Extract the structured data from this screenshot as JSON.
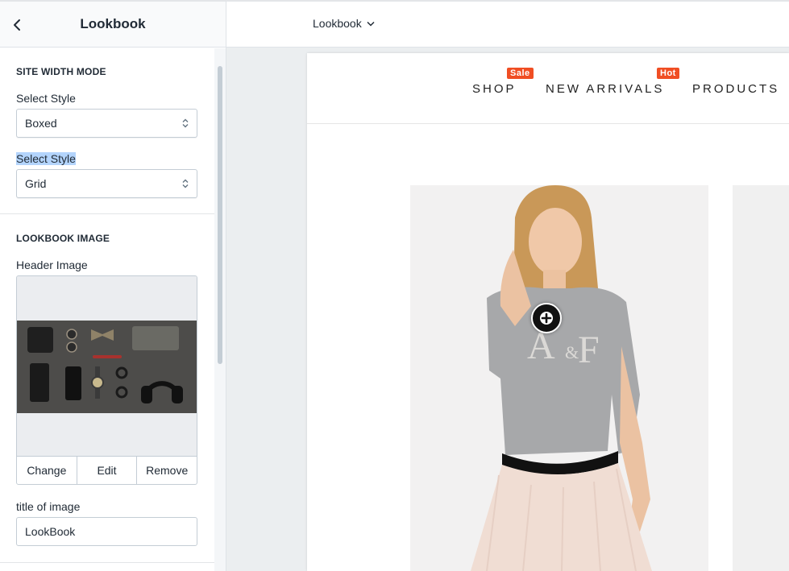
{
  "panel": {
    "title": "Lookbook"
  },
  "site_width_section": {
    "heading": "SITE WIDTH MODE",
    "fields": [
      {
        "label": "Select Style",
        "value": "Boxed"
      },
      {
        "label": "Select Style",
        "value": "Grid"
      }
    ]
  },
  "lookbook_image_section": {
    "heading": "LOOKBOOK IMAGE",
    "header_image_label": "Header Image",
    "actions": {
      "change": "Change",
      "edit": "Edit",
      "remove": "Remove"
    },
    "title_label": "title of image",
    "title_value": "LookBook"
  },
  "topbar": {
    "page_selector": "Lookbook"
  },
  "preview": {
    "nav": [
      {
        "label": "SHOP",
        "badge": "Sale"
      },
      {
        "label": "NEW ARRIVALS",
        "badge": "Hot"
      },
      {
        "label": "PRODUCTS",
        "badge": ""
      }
    ]
  },
  "colors": {
    "badge": "#f04e23",
    "selection_highlight": "#b3d4fc",
    "preview_background": "#ebeef0"
  },
  "icons": {
    "back": "chevron-left-icon",
    "select": "select-arrows-icon",
    "dropdown": "chevron-down-icon",
    "hotspot": "plus-icon"
  }
}
